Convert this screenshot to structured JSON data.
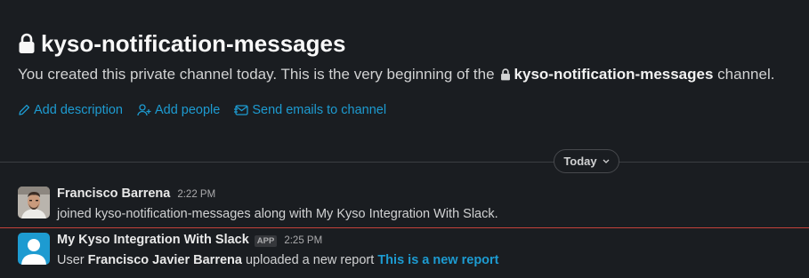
{
  "channel": {
    "name": "kyso-notification-messages",
    "intro_prefix": "You created this private channel today. This is the very beginning of the",
    "intro_suffix": "channel.",
    "actions": [
      {
        "label": "Add description",
        "icon": "pencil-icon"
      },
      {
        "label": "Add people",
        "icon": "add-person-icon"
      },
      {
        "label": "Send emails to channel",
        "icon": "email-icon"
      }
    ]
  },
  "date_divider": {
    "label": "Today",
    "icon": "chevron-down-icon"
  },
  "messages": [
    {
      "sender": "Francisco Barrena",
      "time": "2:22 PM",
      "text": "joined kyso-notification-messages along with My Kyso Integration With Slack."
    },
    {
      "sender": "My Kyso Integration With Slack",
      "badge": "APP",
      "time": "2:25 PM",
      "text_prefix": "User",
      "user_name": "Francisco Javier Barrena",
      "text_middle": "uploaded a new report",
      "link_text": "This is a new report"
    }
  ],
  "colors": {
    "background": "#1a1d21",
    "link": "#1d9bd1",
    "new_message_line": "#c4423b",
    "app_avatar": "#1d9bd1"
  }
}
